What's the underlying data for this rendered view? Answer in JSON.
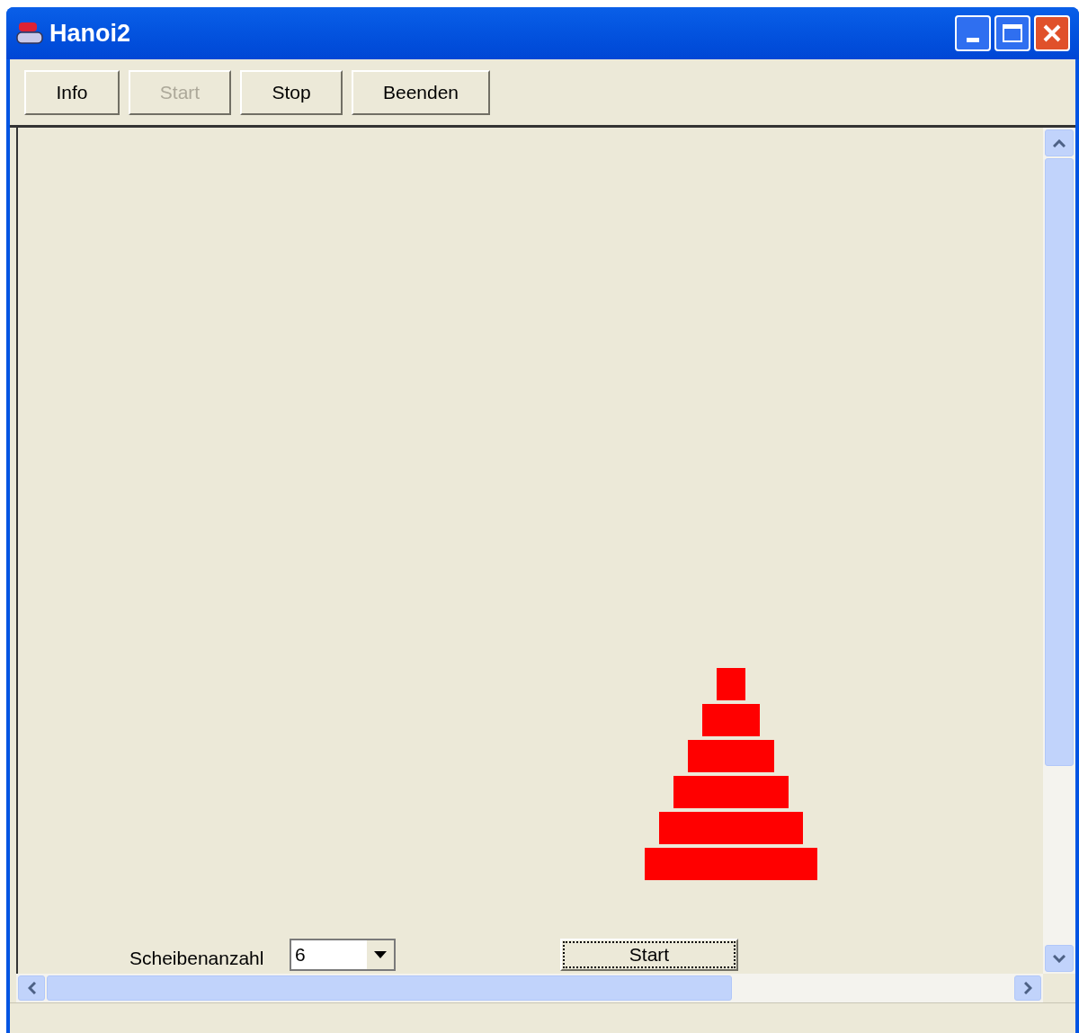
{
  "window": {
    "title": "Hanoi2"
  },
  "toolbar": [
    {
      "label": "Info",
      "disabled": false
    },
    {
      "label": "Start",
      "disabled": true
    },
    {
      "label": "Stop",
      "disabled": false
    },
    {
      "label": "Beenden",
      "disabled": false
    }
  ],
  "controls": {
    "disk_count_label": "Scheibenanzahl",
    "disk_count": {
      "value": "6"
    },
    "start_button": {
      "label": "Start",
      "focused": true
    }
  }
}
